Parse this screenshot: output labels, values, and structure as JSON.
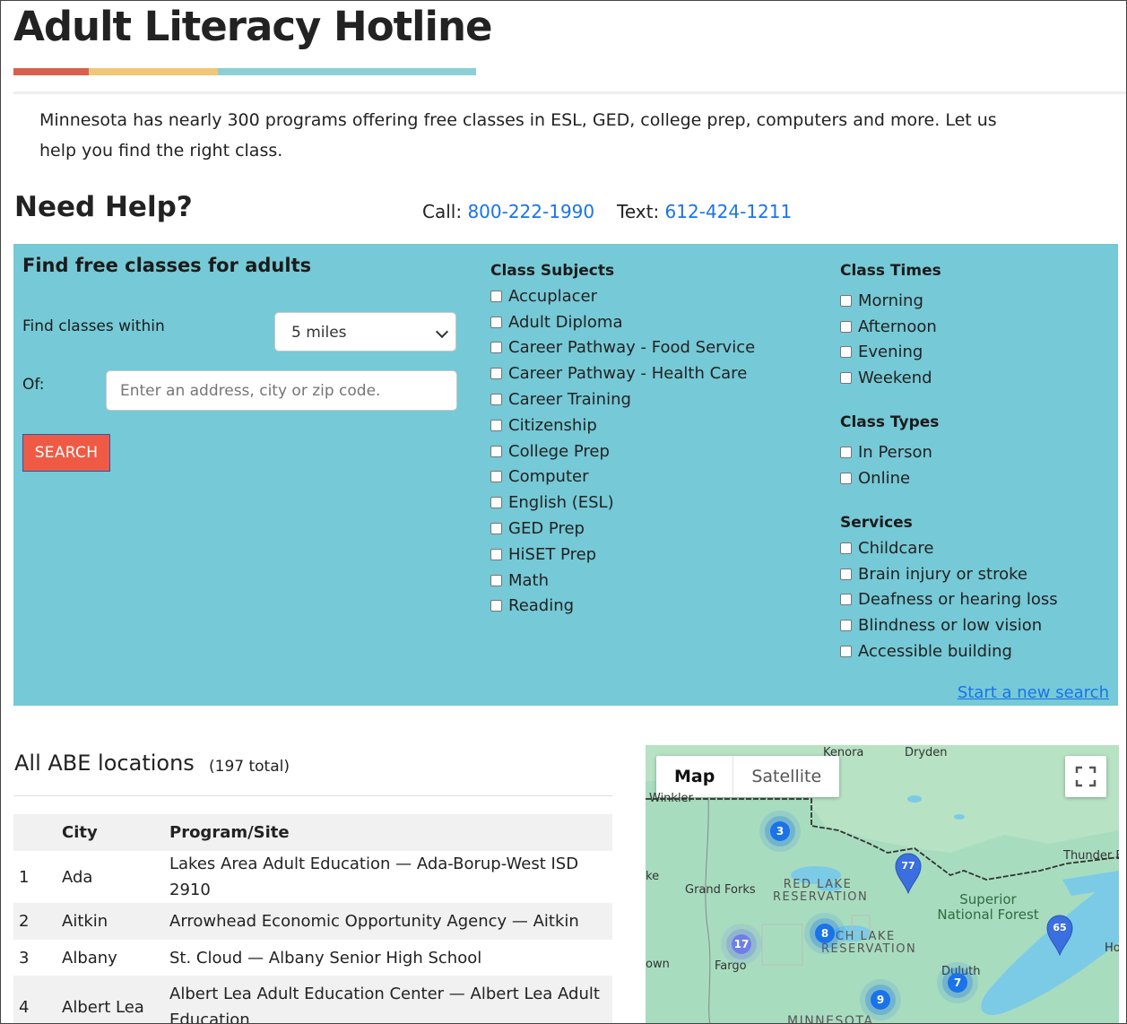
{
  "page": {
    "title": "Adult Literacy Hotline",
    "intro": "Minnesota has nearly 300 programs offering free classes in ESL, GED, college prep, computers and more. Let us help you find the right class.",
    "colors": {
      "bar_red": "#d9604c",
      "bar_yellow": "#f0c777",
      "bar_teal": "#8ccfd6",
      "panel": "#76c9d6",
      "search_button": "#ef5a45",
      "link": "#1a73e8"
    }
  },
  "help": {
    "heading": "Need Help?",
    "call_label": "Call:",
    "call_number": "800-222-1990",
    "text_label": "Text:",
    "text_number": "612-424-1211"
  },
  "search": {
    "heading": "Find free classes for adults",
    "within_label": "Find classes within",
    "within_value": "5 miles",
    "of_label": "Of:",
    "address_placeholder": "Enter an address, city or zip code.",
    "button_label": "SEARCH",
    "new_search_label": "Start a new search"
  },
  "subjects": {
    "heading": "Class Subjects",
    "items": [
      "Accuplacer",
      "Adult Diploma",
      "Career Pathway - Food Service",
      "Career Pathway - Health Care",
      "Career Training",
      "Citizenship",
      "College Prep",
      "Computer",
      "English (ESL)",
      "GED Prep",
      "HiSET Prep",
      "Math",
      "Reading"
    ]
  },
  "times": {
    "heading": "Class Times",
    "items": [
      "Morning",
      "Afternoon",
      "Evening",
      "Weekend"
    ]
  },
  "types": {
    "heading": "Class Types",
    "items": [
      "In Person",
      "Online"
    ]
  },
  "services": {
    "heading": "Services",
    "items": [
      "Childcare",
      "Brain injury or stroke",
      "Deafness or hearing loss",
      "Blindness or low vision",
      "Accessible building"
    ]
  },
  "locations": {
    "title": "All ABE locations",
    "total": "(197 total)",
    "columns": [
      "",
      "City",
      "Program/Site"
    ],
    "rows": [
      {
        "num": "1",
        "city": "Ada",
        "program": "Lakes Area Adult Education — Ada-Borup-West ISD 2910"
      },
      {
        "num": "2",
        "city": "Aitkin",
        "program": "Arrowhead Economic Opportunity Agency — Aitkin"
      },
      {
        "num": "3",
        "city": "Albany",
        "program": "St. Cloud — Albany Senior High School"
      },
      {
        "num": "4",
        "city": "Albert Lea",
        "program": "Albert Lea Adult Education Center — Albert Lea Adult Education"
      }
    ]
  },
  "map": {
    "type_map": "Map",
    "type_satellite": "Satellite",
    "labels": {
      "kenora": "Kenora",
      "dryden": "Dryden",
      "thunder_bay": "Thunder B",
      "grand_forks": "Grand Forks",
      "fargo": "Fargo",
      "duluth": "Duluth",
      "winkler": "Winkler",
      "lake": "ke",
      "town": "own",
      "ho": "Ho",
      "red_lake": "RED LAKE RESERVATION",
      "leech_lake_a": "CH LAKE",
      "leech_lake_b": "RESERVATION",
      "superior": "Superior National Forest",
      "minnesota": "MINNESOTA"
    },
    "clusters": [
      "3",
      "17",
      "8",
      "9",
      "7"
    ],
    "pins": [
      "77",
      "65"
    ]
  }
}
